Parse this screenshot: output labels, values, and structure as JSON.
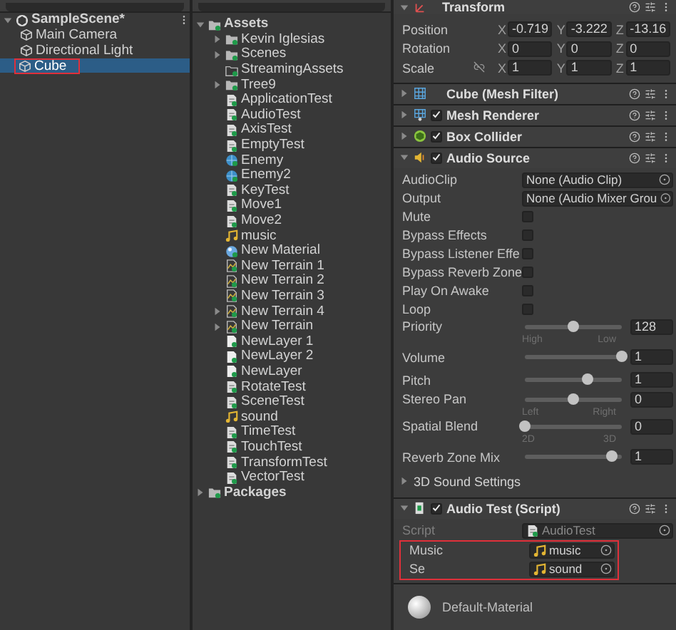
{
  "hierarchy": {
    "scene": "SampleScene*",
    "items": [
      {
        "label": "Main Camera",
        "selected": false,
        "highlighted": false
      },
      {
        "label": "Directional Light",
        "selected": false,
        "highlighted": false
      },
      {
        "label": "Cube",
        "selected": true,
        "highlighted": true
      }
    ]
  },
  "project": {
    "items": [
      {
        "label": "Assets",
        "kind": "folder",
        "expanded": true,
        "children": [
          {
            "label": "Kevin Iglesias",
            "kind": "folder",
            "expanded": false
          },
          {
            "label": "Scenes",
            "kind": "folder",
            "expanded": false
          },
          {
            "label": "StreamingAssets",
            "kind": "empty-folder"
          },
          {
            "label": "Tree9",
            "kind": "folder",
            "expanded": false
          },
          {
            "label": "ApplicationTest",
            "kind": "script"
          },
          {
            "label": "AudioTest",
            "kind": "script"
          },
          {
            "label": "AxisTest",
            "kind": "script"
          },
          {
            "label": "EmptyTest",
            "kind": "script"
          },
          {
            "label": "Enemy",
            "kind": "sphere"
          },
          {
            "label": "Enemy2",
            "kind": "sphere"
          },
          {
            "label": "KeyTest",
            "kind": "script"
          },
          {
            "label": "Move1",
            "kind": "script"
          },
          {
            "label": "Move2",
            "kind": "script"
          },
          {
            "label": "music",
            "kind": "audio"
          },
          {
            "label": "New Material",
            "kind": "material"
          },
          {
            "label": "New Terrain 1",
            "kind": "terrain"
          },
          {
            "label": "New Terrain 2",
            "kind": "terrain"
          },
          {
            "label": "New Terrain 3",
            "kind": "terrain"
          },
          {
            "label": "New Terrain 4",
            "kind": "terrain",
            "expanded": false
          },
          {
            "label": "New Terrain",
            "kind": "terrain",
            "expanded": false
          },
          {
            "label": "NewLayer 1",
            "kind": "asset"
          },
          {
            "label": "NewLayer 2",
            "kind": "asset"
          },
          {
            "label": "NewLayer",
            "kind": "asset"
          },
          {
            "label": "RotateTest",
            "kind": "script"
          },
          {
            "label": "SceneTest",
            "kind": "script"
          },
          {
            "label": "sound",
            "kind": "audio"
          },
          {
            "label": "TimeTest",
            "kind": "script"
          },
          {
            "label": "TouchTest",
            "kind": "script"
          },
          {
            "label": "TransformTest",
            "kind": "script"
          },
          {
            "label": "VectorTest",
            "kind": "script"
          }
        ]
      },
      {
        "label": "Packages",
        "kind": "folder",
        "expanded": false
      }
    ]
  },
  "inspector": {
    "transform": {
      "title": "Transform",
      "expanded": true,
      "rows": [
        {
          "label": "Position",
          "linked": false,
          "axes": [
            {
              "axis": "X",
              "value": "-0.719"
            },
            {
              "axis": "Y",
              "value": "-3.222"
            },
            {
              "axis": "Z",
              "value": "-13.16"
            }
          ]
        },
        {
          "label": "Rotation",
          "linked": false,
          "axes": [
            {
              "axis": "X",
              "value": "0"
            },
            {
              "axis": "Y",
              "value": "0"
            },
            {
              "axis": "Z",
              "value": "0"
            }
          ]
        },
        {
          "label": "Scale",
          "linked": true,
          "axes": [
            {
              "axis": "X",
              "value": "1"
            },
            {
              "axis": "Y",
              "value": "1"
            },
            {
              "axis": "Z",
              "value": "1"
            }
          ]
        }
      ]
    },
    "components": [
      {
        "title": "Cube (Mesh Filter)",
        "kind": "mesh-filter",
        "expanded": false
      },
      {
        "title": "Mesh Renderer",
        "kind": "mesh-renderer",
        "expanded": false,
        "enabled": true
      },
      {
        "title": "Box Collider",
        "kind": "collider",
        "expanded": false,
        "enabled": true
      },
      {
        "title": "Audio Source",
        "kind": "audio-source",
        "expanded": true,
        "enabled": true,
        "fields": [
          {
            "kind": "object",
            "label": "AudioClip",
            "value": "None (Audio Clip)"
          },
          {
            "kind": "object",
            "label": "Output",
            "value": "None (Audio Mixer Grou"
          },
          {
            "kind": "checkbox",
            "label": "Mute",
            "checked": false
          },
          {
            "kind": "checkbox",
            "label": "Bypass Effects",
            "checked": false
          },
          {
            "kind": "checkbox",
            "label": "Bypass Listener Effe",
            "checked": false
          },
          {
            "kind": "checkbox",
            "label": "Bypass Reverb Zone",
            "checked": false
          },
          {
            "kind": "checkbox",
            "label": "Play On Awake",
            "checked": false
          },
          {
            "kind": "checkbox",
            "label": "Loop",
            "checked": false
          },
          {
            "kind": "slider",
            "label": "Priority",
            "level": 0.5,
            "value": "128",
            "range": [
              "High",
              "Low"
            ]
          },
          {
            "kind": "slider",
            "label": "Volume",
            "level": 1,
            "value": "1"
          },
          {
            "kind": "slider",
            "label": "Pitch",
            "level": 0.65,
            "value": "1"
          },
          {
            "kind": "slider",
            "label": "Stereo Pan",
            "level": 0.5,
            "value": "0",
            "range": [
              "Left",
              "Right"
            ]
          },
          {
            "kind": "slider",
            "label": "Spatial Blend",
            "level": 0,
            "value": "0",
            "range": [
              "2D",
              "3D"
            ]
          },
          {
            "kind": "slider",
            "label": "Reverb Zone Mix",
            "level": 0.9,
            "value": "1"
          },
          {
            "kind": "foldout",
            "label": "3D Sound Settings",
            "expanded": false
          }
        ]
      },
      {
        "title": "Audio Test (Script)",
        "kind": "script",
        "expanded": true,
        "enabled": true,
        "fields": [
          {
            "kind": "script-ref",
            "label": "Script",
            "value": "AudioTest",
            "disabled": true,
            "highlighted": false
          },
          {
            "kind": "audio-ref",
            "label": "Music",
            "value": "music",
            "highlighted": true
          },
          {
            "kind": "audio-ref",
            "label": "Se",
            "value": "sound",
            "highlighted": true
          }
        ]
      }
    ],
    "material": {
      "title": "Default-Material"
    }
  }
}
